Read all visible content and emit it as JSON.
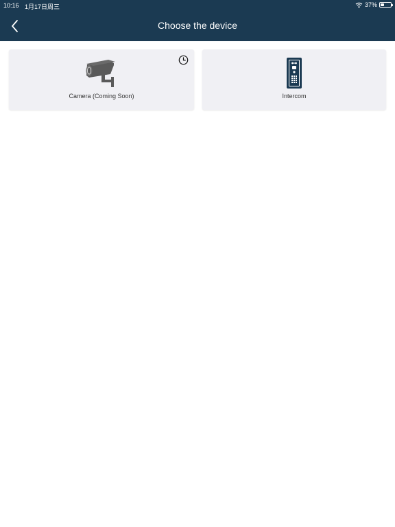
{
  "status_bar": {
    "time": "10:16",
    "date": "1月17日周三",
    "battery": "37%"
  },
  "header": {
    "title": "Choose the device",
    "back_icon": "chevron-left-icon"
  },
  "devices": [
    {
      "label": "Camera (Coming Soon)",
      "icon": "security-camera-icon",
      "status_icon": "clock-icon"
    },
    {
      "label": "Intercom",
      "icon": "intercom-icon"
    }
  ],
  "colors": {
    "header_bg": "#1b3a52",
    "card_bg": "#f0f0f4",
    "icon_gray": "#5a5a5a",
    "intercom_blue": "#1b3a52"
  }
}
